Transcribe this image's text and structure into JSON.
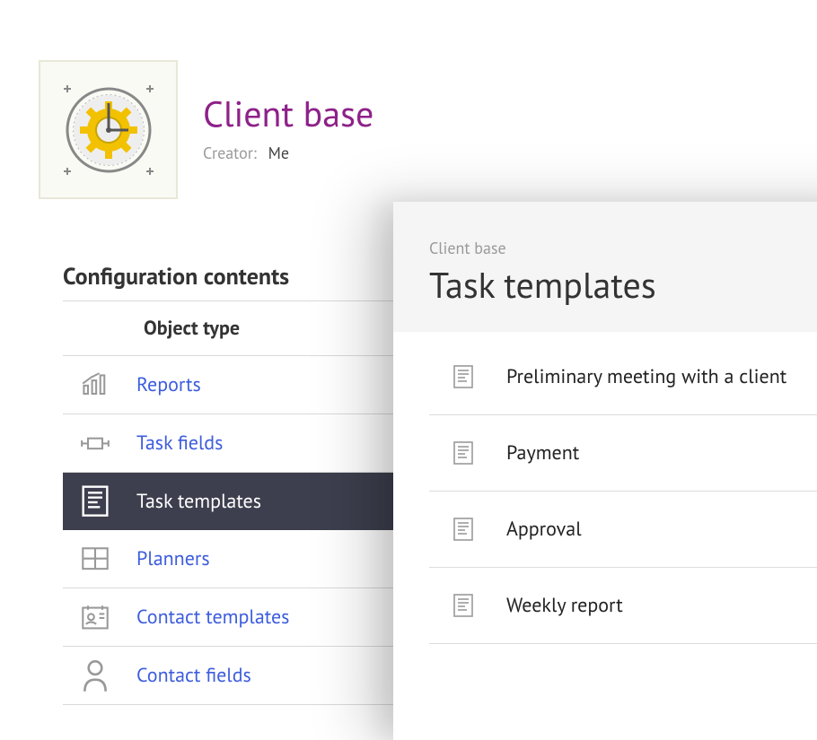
{
  "header": {
    "title": "Client base",
    "creator_label": "Creator:",
    "creator_value": "Me"
  },
  "config": {
    "section_title": "Configuration contents",
    "column_header": "Object type",
    "items": [
      {
        "label": "Reports"
      },
      {
        "label": "Task fields"
      },
      {
        "label": "Task templates"
      },
      {
        "label": "Planners"
      },
      {
        "label": "Contact templates"
      },
      {
        "label": "Contact fields"
      }
    ]
  },
  "overlay": {
    "breadcrumb": "Client base",
    "title": "Task templates",
    "templates": [
      {
        "name": "Preliminary meeting with a client"
      },
      {
        "name": "Payment"
      },
      {
        "name": "Approval"
      },
      {
        "name": "Weekly report"
      }
    ]
  }
}
